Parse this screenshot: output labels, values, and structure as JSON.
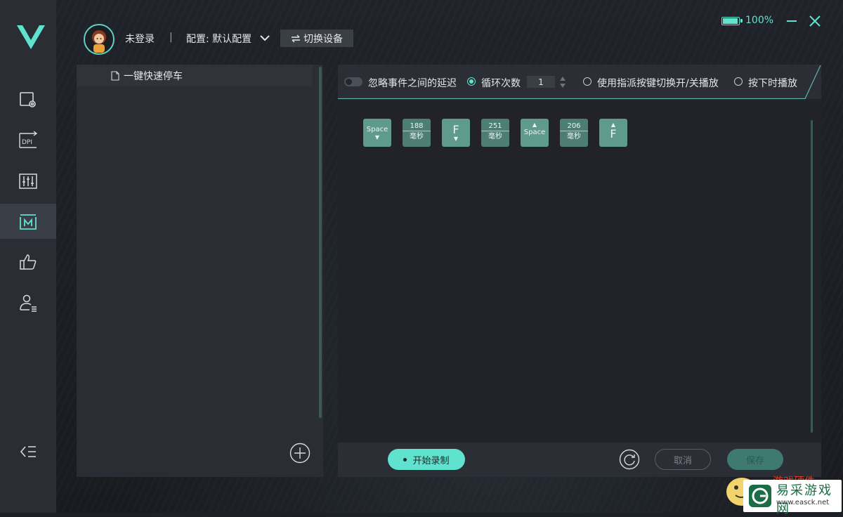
{
  "header": {
    "login_status": "未登录",
    "separator": "|",
    "config_label": "配置: 默认配置",
    "switch_device": "切换设备",
    "battery_percent": "100%",
    "battery_level": 1.0
  },
  "sidebar": {
    "items": [
      {
        "name": "key-settings",
        "icon": "screen-gear-icon"
      },
      {
        "name": "dpi",
        "icon": "dpi-icon",
        "label": "DPI"
      },
      {
        "name": "performance",
        "icon": "sliders-icon"
      },
      {
        "name": "macro",
        "icon": "macro-icon",
        "active": true
      },
      {
        "name": "rating",
        "icon": "thumbs-up-icon"
      },
      {
        "name": "account",
        "icon": "user-list-icon"
      }
    ],
    "collapse_icon": "collapse-menu-icon"
  },
  "macro_list": {
    "items": [
      {
        "label": "一键快速停车"
      }
    ]
  },
  "options": {
    "ignore_delay": "忽略事件之间的延迟",
    "loop_count": "循环次数",
    "loop_value": "1",
    "toggle_play": "使用指派按键切换开/关播放",
    "press_play": "按下时播放"
  },
  "keys": [
    {
      "type": "key",
      "label": "Space",
      "dir": "down"
    },
    {
      "type": "delay",
      "value": "188",
      "unit": "毫秒"
    },
    {
      "type": "key",
      "label": "F",
      "dir": "down"
    },
    {
      "type": "delay",
      "value": "251",
      "unit": "毫秒"
    },
    {
      "type": "key",
      "label": "Space",
      "dir": "up"
    },
    {
      "type": "delay",
      "value": "206",
      "unit": "毫秒"
    },
    {
      "type": "key",
      "label": "F",
      "dir": "up"
    }
  ],
  "bottom": {
    "record": "开始录制",
    "cancel": "取消",
    "save": "保存"
  },
  "watermark": {
    "site_cn": "易采游戏网",
    "site_url": "www.easck.net",
    "overlay_text": "游戏硬件"
  },
  "colors": {
    "accent": "#5fe3cf",
    "key_bg": "#5e9a8e",
    "sidebar_bg": "#2a2d34"
  }
}
